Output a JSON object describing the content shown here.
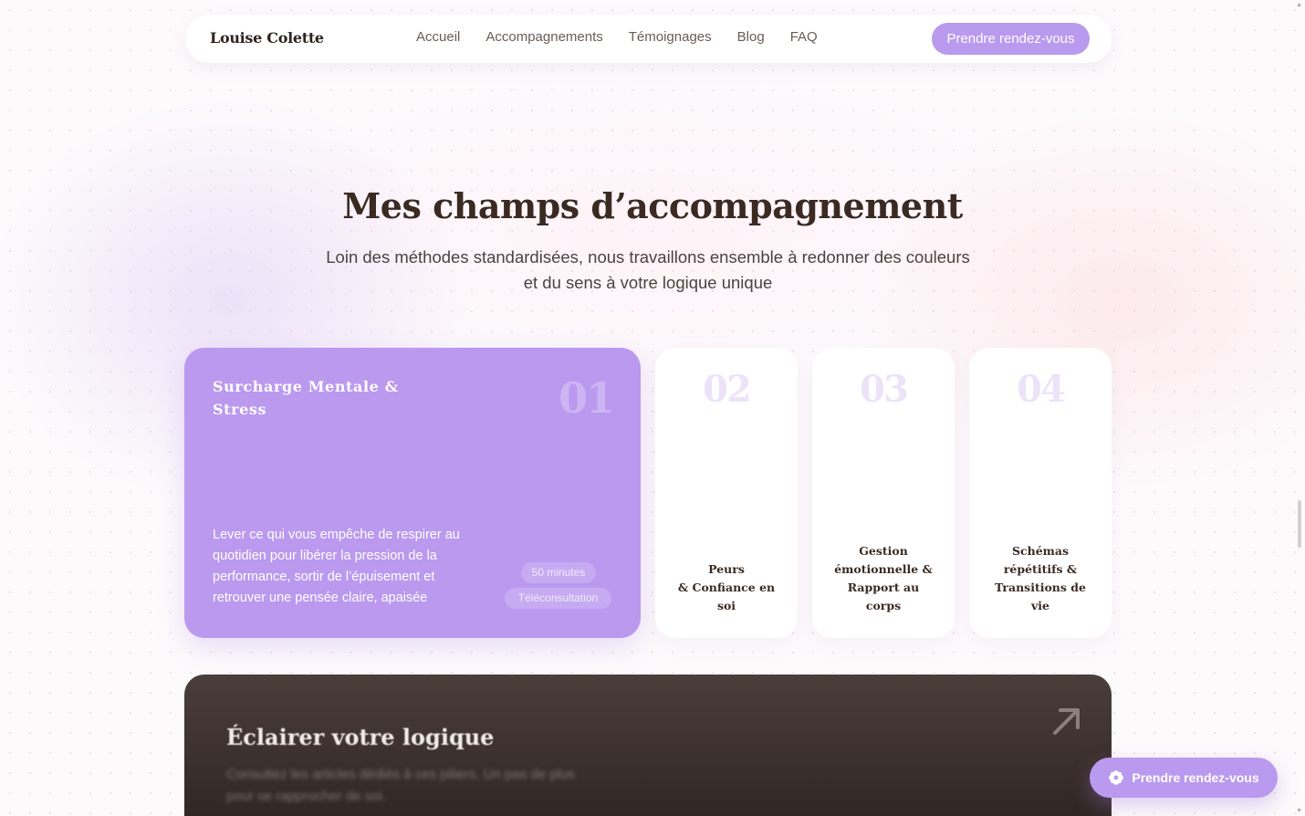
{
  "nav": {
    "brand": "Louise Colette",
    "links": [
      "Accueil",
      "Accompagnements",
      "Témoignages",
      "Blog",
      "FAQ"
    ],
    "cta": "Prendre rendez-vous"
  },
  "section": {
    "title": "Mes champs d’accompagnement",
    "subtitle_line1": "Loin des méthodes standardisées, nous travaillons ensemble à redonner des couleurs",
    "subtitle_line2": "et du sens à votre logique unique"
  },
  "cards": [
    {
      "num": "01",
      "title": "Surcharge Mentale & Stress",
      "description": "Lever ce qui vous empêche de respirer au quotidien pour libérer la pression de la performance, sortir de l’épuisement et retrouver une pensée claire, apaisée",
      "tags": [
        "50 minutes",
        "Téléconsultation"
      ]
    },
    {
      "num": "02",
      "label_lines": [
        "Peurs",
        "& Confiance en",
        "soi"
      ]
    },
    {
      "num": "03",
      "label_lines": [
        "Gestion",
        "émotionnelle &",
        "Rapport au",
        "corps"
      ]
    },
    {
      "num": "04",
      "label_lines": [
        "Schémas",
        "répétitifs &",
        "Transitions de",
        "vie"
      ]
    }
  ],
  "blog_card": {
    "title": "Éclairer votre logique",
    "text_line1": "Consultez les articles dédiés à ces piliers. Un pas de plus",
    "text_line2": "pour se rapprocher de soi.",
    "icon": "arrow-up-right-icon"
  },
  "floating_cta": {
    "label": "Prendre rendez-vous",
    "icon": "flower-icon"
  },
  "colors": {
    "accent": "#b99aee",
    "dark": "#3a2e2a",
    "background": "#fdfafc"
  }
}
